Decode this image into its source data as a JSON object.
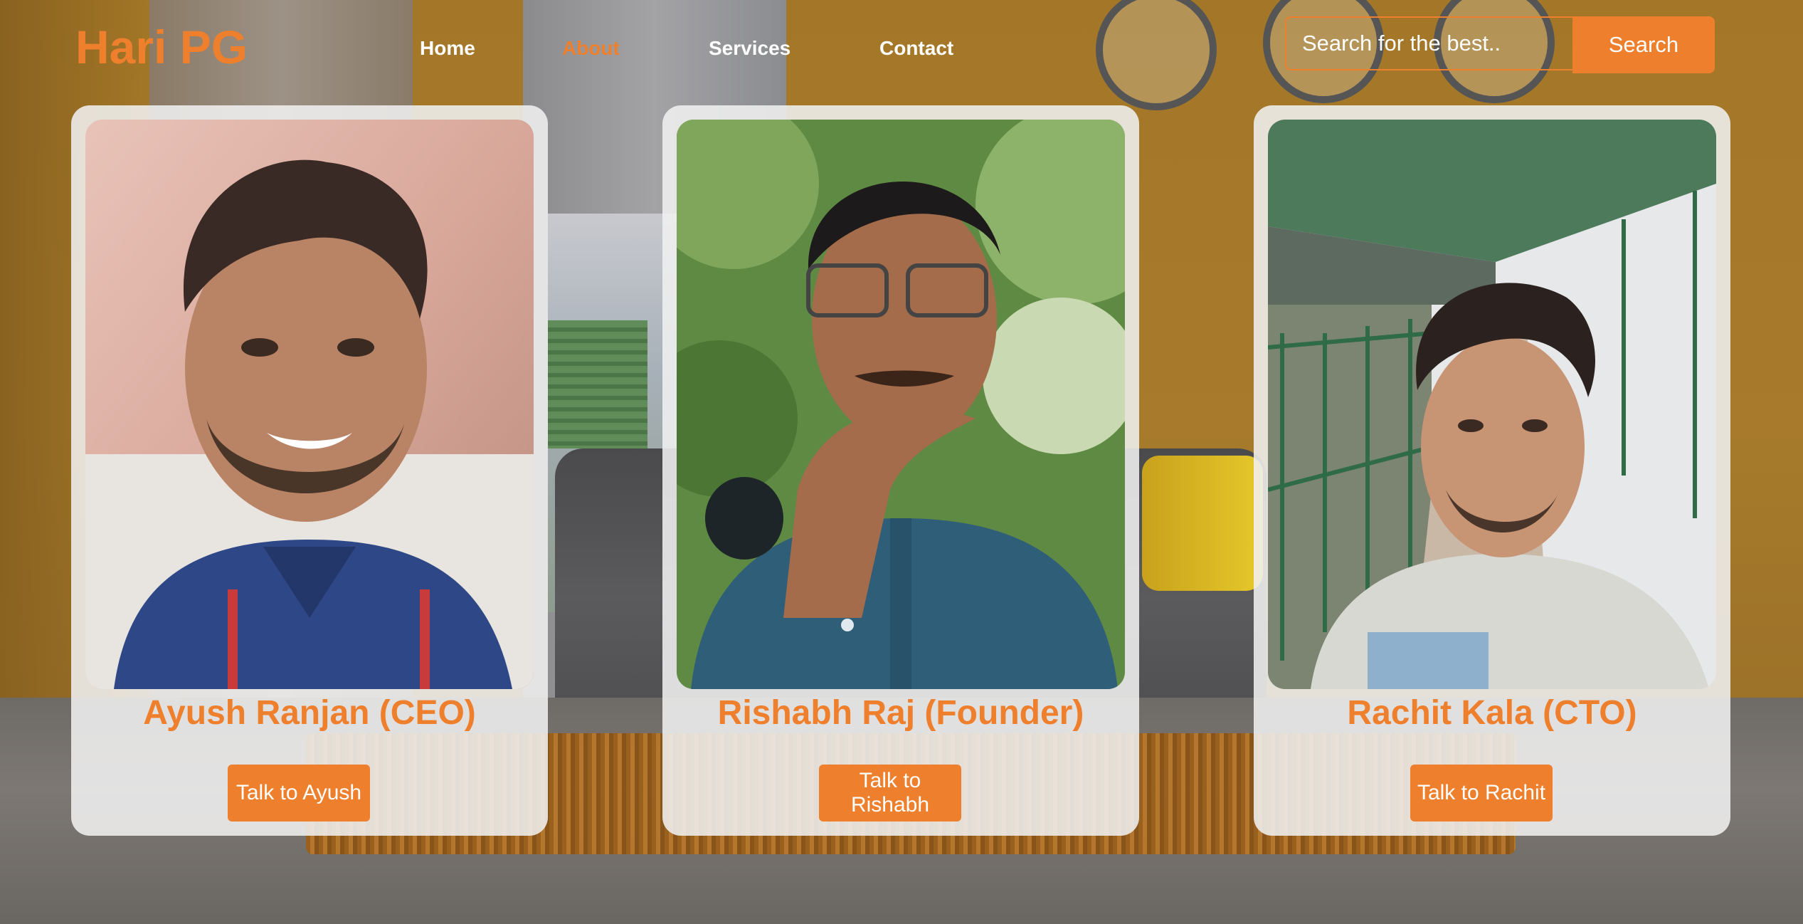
{
  "brand": {
    "logo": "Hari PG",
    "accent_color": "#ee7f2d"
  },
  "nav": {
    "items": [
      {
        "label": "Home",
        "active": false
      },
      {
        "label": "About",
        "active": true
      },
      {
        "label": "Services",
        "active": false
      },
      {
        "label": "Contact",
        "active": false
      }
    ]
  },
  "search": {
    "placeholder": "Search for the best..",
    "button_label": "Search"
  },
  "team": [
    {
      "name": "Ayush Ranjan (CEO)",
      "button_label": "Talk to Ayush",
      "photo_icon": "person-photo"
    },
    {
      "name": "Rishabh Raj (Founder)",
      "button_label": "Talk to Rishabh",
      "photo_icon": "person-photo"
    },
    {
      "name": "Rachit Kala (CTO)",
      "button_label": "Talk to Rachit",
      "photo_icon": "person-photo"
    }
  ]
}
